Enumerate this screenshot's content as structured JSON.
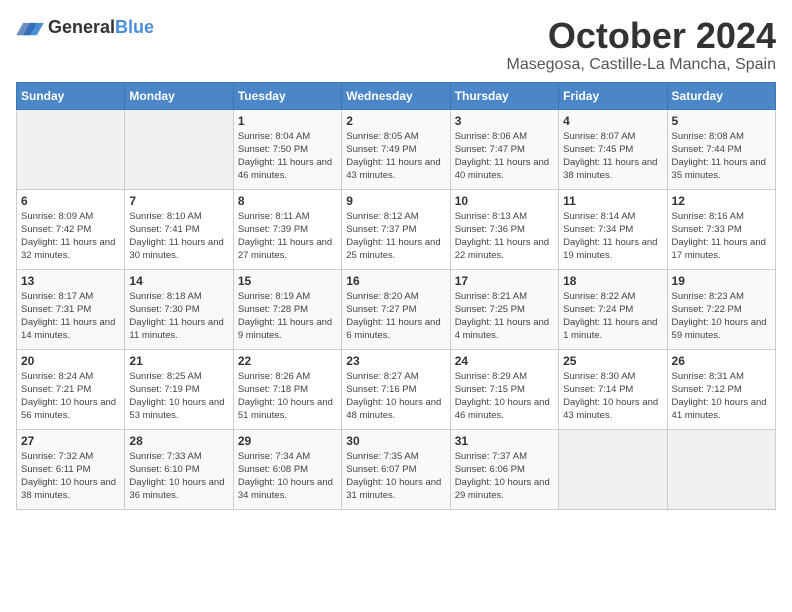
{
  "header": {
    "logo_general": "General",
    "logo_blue": "Blue",
    "month_title": "October 2024",
    "location": "Masegosa, Castille-La Mancha, Spain"
  },
  "weekdays": [
    "Sunday",
    "Monday",
    "Tuesday",
    "Wednesday",
    "Thursday",
    "Friday",
    "Saturday"
  ],
  "weeks": [
    [
      {
        "day": "",
        "info": ""
      },
      {
        "day": "",
        "info": ""
      },
      {
        "day": "1",
        "info": "Sunrise: 8:04 AM\nSunset: 7:50 PM\nDaylight: 11 hours and 46 minutes."
      },
      {
        "day": "2",
        "info": "Sunrise: 8:05 AM\nSunset: 7:49 PM\nDaylight: 11 hours and 43 minutes."
      },
      {
        "day": "3",
        "info": "Sunrise: 8:06 AM\nSunset: 7:47 PM\nDaylight: 11 hours and 40 minutes."
      },
      {
        "day": "4",
        "info": "Sunrise: 8:07 AM\nSunset: 7:45 PM\nDaylight: 11 hours and 38 minutes."
      },
      {
        "day": "5",
        "info": "Sunrise: 8:08 AM\nSunset: 7:44 PM\nDaylight: 11 hours and 35 minutes."
      }
    ],
    [
      {
        "day": "6",
        "info": "Sunrise: 8:09 AM\nSunset: 7:42 PM\nDaylight: 11 hours and 32 minutes."
      },
      {
        "day": "7",
        "info": "Sunrise: 8:10 AM\nSunset: 7:41 PM\nDaylight: 11 hours and 30 minutes."
      },
      {
        "day": "8",
        "info": "Sunrise: 8:11 AM\nSunset: 7:39 PM\nDaylight: 11 hours and 27 minutes."
      },
      {
        "day": "9",
        "info": "Sunrise: 8:12 AM\nSunset: 7:37 PM\nDaylight: 11 hours and 25 minutes."
      },
      {
        "day": "10",
        "info": "Sunrise: 8:13 AM\nSunset: 7:36 PM\nDaylight: 11 hours and 22 minutes."
      },
      {
        "day": "11",
        "info": "Sunrise: 8:14 AM\nSunset: 7:34 PM\nDaylight: 11 hours and 19 minutes."
      },
      {
        "day": "12",
        "info": "Sunrise: 8:16 AM\nSunset: 7:33 PM\nDaylight: 11 hours and 17 minutes."
      }
    ],
    [
      {
        "day": "13",
        "info": "Sunrise: 8:17 AM\nSunset: 7:31 PM\nDaylight: 11 hours and 14 minutes."
      },
      {
        "day": "14",
        "info": "Sunrise: 8:18 AM\nSunset: 7:30 PM\nDaylight: 11 hours and 11 minutes."
      },
      {
        "day": "15",
        "info": "Sunrise: 8:19 AM\nSunset: 7:28 PM\nDaylight: 11 hours and 9 minutes."
      },
      {
        "day": "16",
        "info": "Sunrise: 8:20 AM\nSunset: 7:27 PM\nDaylight: 11 hours and 6 minutes."
      },
      {
        "day": "17",
        "info": "Sunrise: 8:21 AM\nSunset: 7:25 PM\nDaylight: 11 hours and 4 minutes."
      },
      {
        "day": "18",
        "info": "Sunrise: 8:22 AM\nSunset: 7:24 PM\nDaylight: 11 hours and 1 minute."
      },
      {
        "day": "19",
        "info": "Sunrise: 8:23 AM\nSunset: 7:22 PM\nDaylight: 10 hours and 59 minutes."
      }
    ],
    [
      {
        "day": "20",
        "info": "Sunrise: 8:24 AM\nSunset: 7:21 PM\nDaylight: 10 hours and 56 minutes."
      },
      {
        "day": "21",
        "info": "Sunrise: 8:25 AM\nSunset: 7:19 PM\nDaylight: 10 hours and 53 minutes."
      },
      {
        "day": "22",
        "info": "Sunrise: 8:26 AM\nSunset: 7:18 PM\nDaylight: 10 hours and 51 minutes."
      },
      {
        "day": "23",
        "info": "Sunrise: 8:27 AM\nSunset: 7:16 PM\nDaylight: 10 hours and 48 minutes."
      },
      {
        "day": "24",
        "info": "Sunrise: 8:29 AM\nSunset: 7:15 PM\nDaylight: 10 hours and 46 minutes."
      },
      {
        "day": "25",
        "info": "Sunrise: 8:30 AM\nSunset: 7:14 PM\nDaylight: 10 hours and 43 minutes."
      },
      {
        "day": "26",
        "info": "Sunrise: 8:31 AM\nSunset: 7:12 PM\nDaylight: 10 hours and 41 minutes."
      }
    ],
    [
      {
        "day": "27",
        "info": "Sunrise: 7:32 AM\nSunset: 6:11 PM\nDaylight: 10 hours and 38 minutes."
      },
      {
        "day": "28",
        "info": "Sunrise: 7:33 AM\nSunset: 6:10 PM\nDaylight: 10 hours and 36 minutes."
      },
      {
        "day": "29",
        "info": "Sunrise: 7:34 AM\nSunset: 6:08 PM\nDaylight: 10 hours and 34 minutes."
      },
      {
        "day": "30",
        "info": "Sunrise: 7:35 AM\nSunset: 6:07 PM\nDaylight: 10 hours and 31 minutes."
      },
      {
        "day": "31",
        "info": "Sunrise: 7:37 AM\nSunset: 6:06 PM\nDaylight: 10 hours and 29 minutes."
      },
      {
        "day": "",
        "info": ""
      },
      {
        "day": "",
        "info": ""
      }
    ]
  ]
}
